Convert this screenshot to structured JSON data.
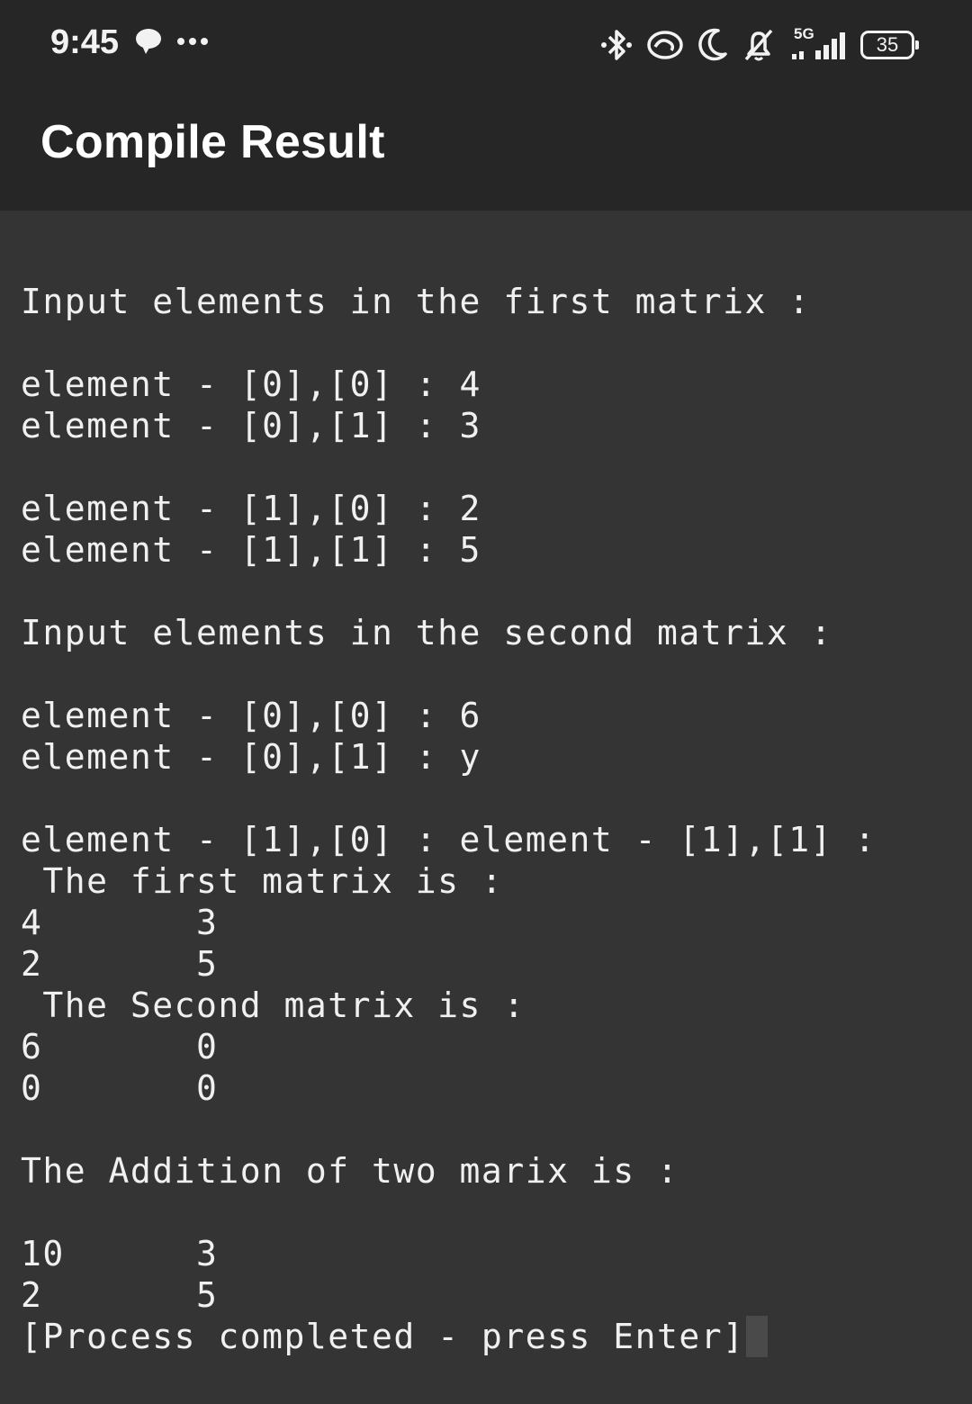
{
  "status_bar": {
    "time": "9:45",
    "network": "5G",
    "battery": "35"
  },
  "toolbar": {
    "title": "Compile Result"
  },
  "terminal": {
    "lines": [
      "Input elements in the first matrix :",
      "",
      "element - [0],[0] : 4",
      "element - [0],[1] : 3",
      "",
      "element - [1],[0] : 2",
      "element - [1],[1] : 5",
      "",
      "Input elements in the second matrix :",
      "",
      "element - [0],[0] : 6",
      "element - [0],[1] : y",
      "",
      "element - [1],[0] : element - [1],[1] :",
      " The first matrix is :",
      "4       3",
      "2       5",
      " The Second matrix is :",
      "6       0",
      "0       0",
      "",
      "The Addition of two marix is :",
      "",
      "10      3",
      "2       5",
      "[Process completed - press Enter]"
    ]
  }
}
